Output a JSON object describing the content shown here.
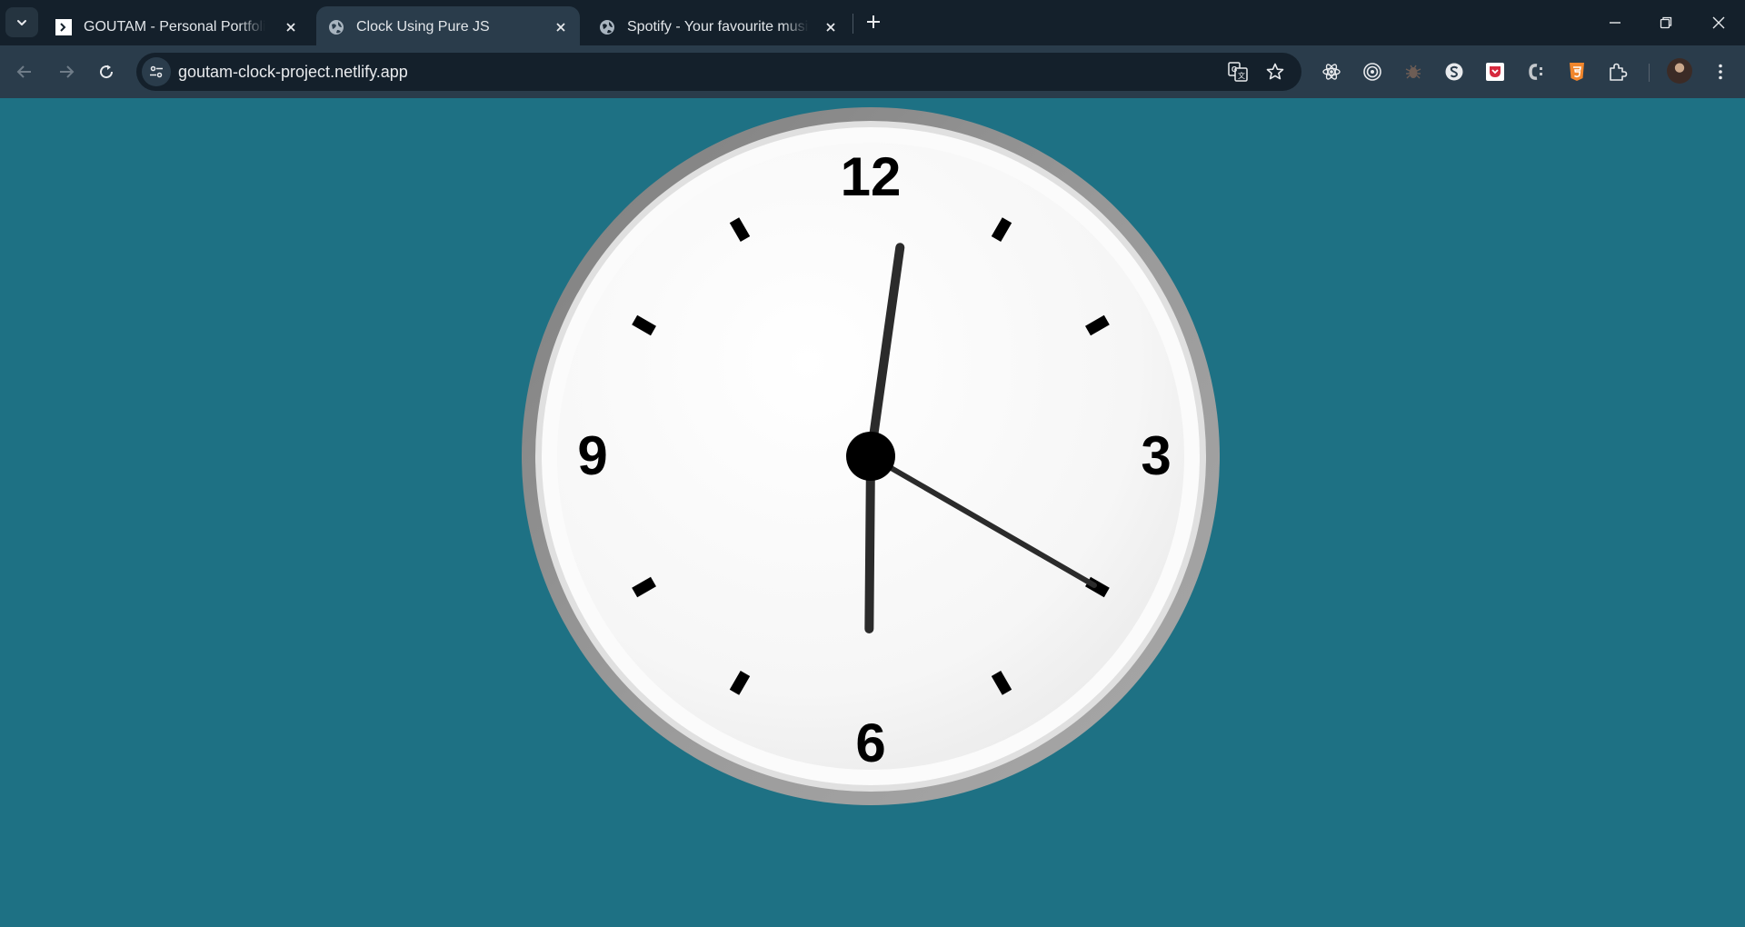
{
  "browser": {
    "tabs": [
      {
        "title": "GOUTAM - Personal Portfolio Te",
        "favicon": "portfolio-favicon",
        "active": false
      },
      {
        "title": "Clock Using Pure JS",
        "favicon": "globe-icon",
        "active": true
      },
      {
        "title": "Spotify - Your favourite music is",
        "favicon": "globe-icon",
        "active": false
      }
    ],
    "url": "goutam-clock-project.netlify.app",
    "extensions": [
      "react-devtools-icon",
      "target-icon",
      "bug-icon",
      "s-circle-icon",
      "pocket-icon",
      "css-icon",
      "html5-icon",
      "puzzle-icon"
    ]
  },
  "clock": {
    "numerals": {
      "twelve": "12",
      "three": "3",
      "six": "6",
      "nine": "9"
    },
    "time": {
      "hour": 6,
      "minute": 1,
      "second": 20
    },
    "colors": {
      "background": "#1e7184",
      "face": "#ffffff",
      "bezel": "#8f8f8f",
      "hands": "#2b2b2b",
      "ticks": "#000000"
    }
  }
}
